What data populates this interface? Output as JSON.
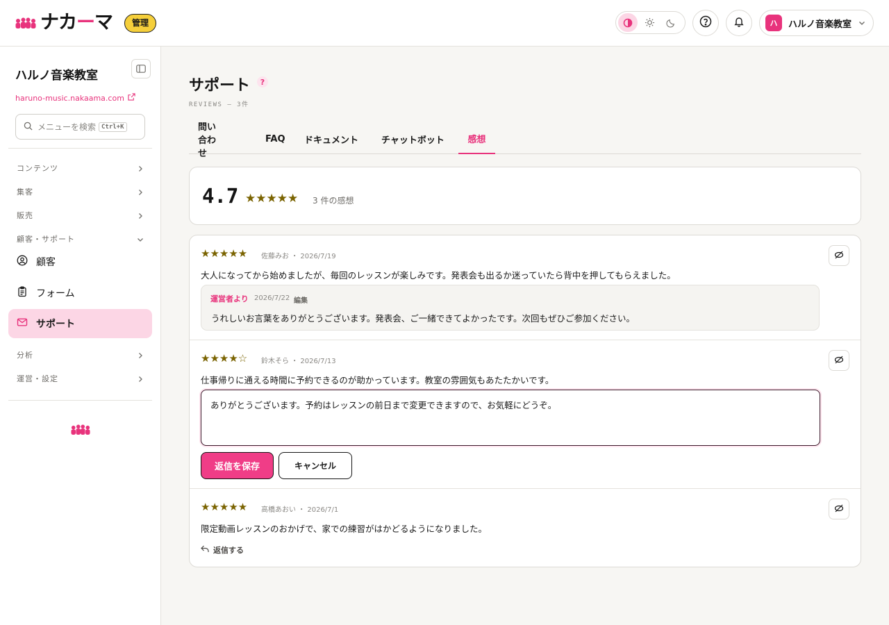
{
  "header": {
    "logo_pre": "ナカ",
    "logo_dash": "ー",
    "logo_post": "マ",
    "admin_badge": "管理",
    "account": {
      "avatar_text": "ハ",
      "name": "ハルノ音楽教室"
    },
    "theme_options": [
      "contrast-icon",
      "sun-icon",
      "moon-icon"
    ],
    "icons": {
      "help": "question-circle-icon",
      "notifications": "bell-icon",
      "chevron": "chevron-down-icon"
    }
  },
  "sidebar": {
    "site_title": "ハルノ音楽教室",
    "site_url": "haruno-music.nakaama.com",
    "search": {
      "placeholder": "メニューを検索",
      "shortcut": "Ctrl+K"
    },
    "groups": [
      {
        "label": "コンテンツ",
        "expanded": false
      },
      {
        "label": "集客",
        "expanded": false
      },
      {
        "label": "販売",
        "expanded": false
      },
      {
        "label": "顧客・サポート",
        "expanded": true
      },
      {
        "label": "分析",
        "expanded": false
      },
      {
        "label": "運営・設定",
        "expanded": false
      }
    ],
    "items": [
      {
        "label": "顧客",
        "icon": "user-circle-icon"
      },
      {
        "label": "フォーム",
        "icon": "clipboard-icon"
      },
      {
        "label": "サポート",
        "icon": "mail-icon",
        "active": true
      }
    ]
  },
  "main": {
    "title": "サポート",
    "help_mark": "?",
    "subtitle": "REVIEWS — 3件",
    "tabs": [
      {
        "label": "問い合わせ"
      },
      {
        "label": "FAQ"
      },
      {
        "label": "ドキュメント"
      },
      {
        "label": "チャットボット"
      },
      {
        "label": "感想",
        "active": true
      }
    ],
    "summary": {
      "score": "4.7",
      "stars": "★★★★★",
      "count_text": "3 件の感想"
    },
    "reviews": [
      {
        "stars": "★★★★★",
        "rating": 5,
        "meta": "佐藤みお ・ 2026/7/19",
        "text": "大人になってから始めましたが、毎回のレッスンが楽しみです。発表会も出るか迷っていたら背中を押してもらえました。",
        "reply": {
          "label": "運営者より",
          "date": "2026/7/22",
          "edit_label": "編集",
          "text": "うれしいお言葉をありがとうございます。発表会、ご一緒できてよかったです。次回もぜひご参加ください。"
        }
      },
      {
        "stars": "★★★★☆",
        "rating": 4,
        "meta": "鈴木そら ・ 2026/7/13",
        "text": "仕事帰りに通える時間に予約できるのが助かっています。教室の雰囲気もあたたかいです。",
        "reply_draft": "ありがとうございます。予約はレッスンの前日まで変更できますので、お気軽にどうぞ。",
        "save_label": "返信を保存",
        "cancel_label": "キャンセル"
      },
      {
        "stars": "★★★★★",
        "rating": 5,
        "meta": "高橋あおい ・ 2026/7/1",
        "text": "限定動画レッスンのおかげで、家での練習がはかどるようになりました。",
        "reply_link": "返信する"
      }
    ]
  },
  "colors": {
    "brand_pink": "#e8337c",
    "badge_yellow": "#f5cf3b",
    "star_gold": "#7a6300",
    "active_bg": "#fcd6e5"
  }
}
